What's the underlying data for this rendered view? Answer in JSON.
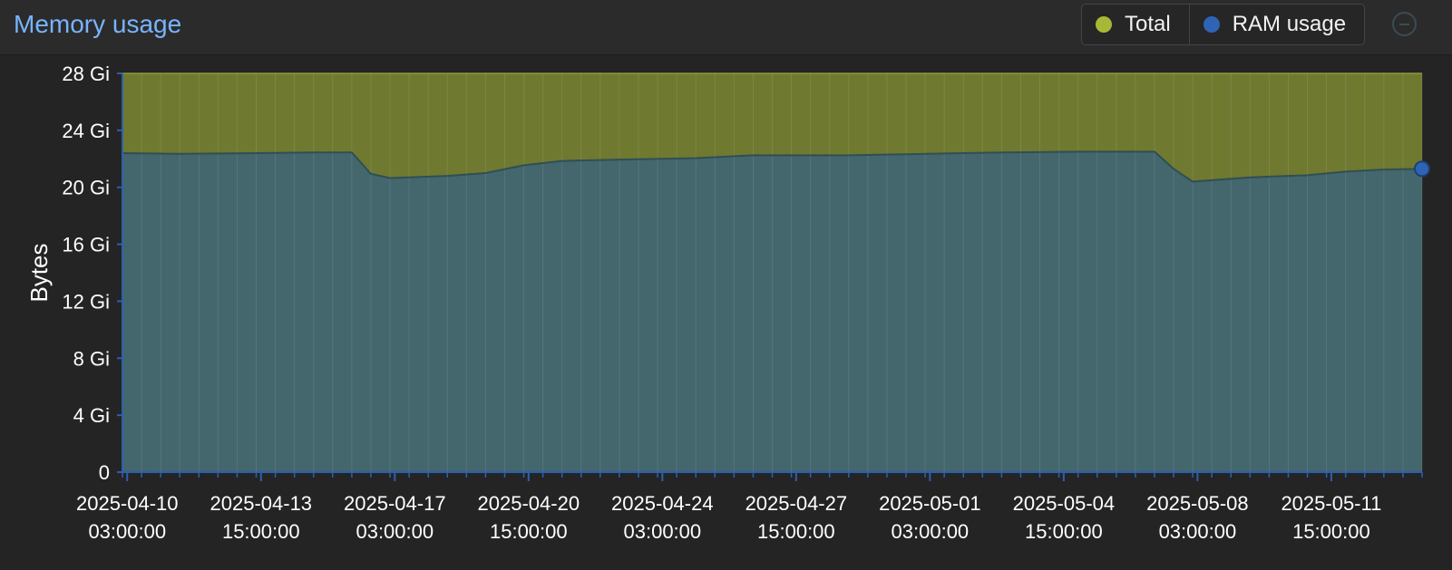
{
  "title": "Memory usage",
  "legend": [
    {
      "label": "Total",
      "color": "#a9b736"
    },
    {
      "label": "RAM usage",
      "color": "#2f64b5"
    }
  ],
  "collapse_button": {
    "icon": "minus-circle-icon"
  },
  "chart_data": {
    "type": "area",
    "title": "Memory usage",
    "ylabel": "Bytes",
    "xlabel": "",
    "ylim": [
      0,
      28
    ],
    "y_unit": "Gi",
    "y_ticks": [
      0,
      4,
      8,
      12,
      16,
      20,
      24,
      28
    ],
    "y_tick_labels": [
      "0",
      "4 Gi",
      "8 Gi",
      "12 Gi",
      "16 Gi",
      "20 Gi",
      "24 Gi",
      "28 Gi"
    ],
    "xlim": [
      "2025-04-10 00:00:00",
      "2025-05-14 00:00:00"
    ],
    "x_ticks": [
      "2025-04-10 03:00:00",
      "2025-04-13 15:00:00",
      "2025-04-17 03:00:00",
      "2025-04-20 15:00:00",
      "2025-04-24 03:00:00",
      "2025-04-27 15:00:00",
      "2025-05-01 03:00:00",
      "2025-05-04 15:00:00",
      "2025-05-08 03:00:00",
      "2025-05-11 15:00:00"
    ],
    "x_tick_labels": [
      [
        "2025-04-10",
        "03:00:00"
      ],
      [
        "2025-04-13",
        "15:00:00"
      ],
      [
        "2025-04-17",
        "03:00:00"
      ],
      [
        "2025-04-20",
        "15:00:00"
      ],
      [
        "2025-04-24",
        "03:00:00"
      ],
      [
        "2025-04-27",
        "15:00:00"
      ],
      [
        "2025-05-01",
        "03:00:00"
      ],
      [
        "2025-05-04",
        "15:00:00"
      ],
      [
        "2025-05-08",
        "03:00:00"
      ],
      [
        "2025-05-11",
        "15:00:00"
      ]
    ],
    "grid": true,
    "legend_position": "top-right",
    "series": [
      {
        "name": "Total",
        "color": "#a9b736",
        "points": [
          {
            "x": "2025-04-10 00:00:00",
            "y": 28
          },
          {
            "x": "2025-05-14 00:00:00",
            "y": 28
          }
        ]
      },
      {
        "name": "RAM usage",
        "color": "#2f64b5",
        "points": [
          {
            "x": "2025-04-10 00:00:00",
            "y": 22.4
          },
          {
            "x": "2025-04-11 12:00:00",
            "y": 22.35
          },
          {
            "x": "2025-04-13 12:00:00",
            "y": 22.4
          },
          {
            "x": "2025-04-15 00:00:00",
            "y": 22.45
          },
          {
            "x": "2025-04-16 00:00:00",
            "y": 22.45
          },
          {
            "x": "2025-04-16 12:00:00",
            "y": 20.95
          },
          {
            "x": "2025-04-17 00:00:00",
            "y": 20.65
          },
          {
            "x": "2025-04-18 12:00:00",
            "y": 20.8
          },
          {
            "x": "2025-04-19 12:00:00",
            "y": 21.0
          },
          {
            "x": "2025-04-20 12:00:00",
            "y": 21.55
          },
          {
            "x": "2025-04-21 12:00:00",
            "y": 21.85
          },
          {
            "x": "2025-04-23 00:00:00",
            "y": 21.95
          },
          {
            "x": "2025-04-25 00:00:00",
            "y": 22.05
          },
          {
            "x": "2025-04-26 12:00:00",
            "y": 22.25
          },
          {
            "x": "2025-04-29 00:00:00",
            "y": 22.25
          },
          {
            "x": "2025-05-01 00:00:00",
            "y": 22.35
          },
          {
            "x": "2025-05-03 00:00:00",
            "y": 22.45
          },
          {
            "x": "2025-05-05 00:00:00",
            "y": 22.5
          },
          {
            "x": "2025-05-07 00:00:00",
            "y": 22.5
          },
          {
            "x": "2025-05-07 12:00:00",
            "y": 21.3
          },
          {
            "x": "2025-05-08 00:00:00",
            "y": 20.4
          },
          {
            "x": "2025-05-09 12:00:00",
            "y": 20.7
          },
          {
            "x": "2025-05-11 00:00:00",
            "y": 20.85
          },
          {
            "x": "2025-05-12 00:00:00",
            "y": 21.1
          },
          {
            "x": "2025-05-13 00:00:00",
            "y": 21.25
          },
          {
            "x": "2025-05-14 00:00:00",
            "y": 21.3
          }
        ]
      }
    ]
  }
}
